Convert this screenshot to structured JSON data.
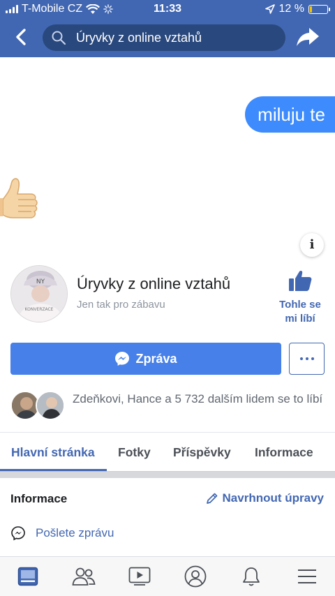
{
  "status_bar": {
    "carrier": "T-Mobile CZ",
    "time": "11:33",
    "battery_percent": "12 %",
    "battery_level": 0.12
  },
  "nav": {
    "search_query": "Úryvky z online vztahů",
    "icons": {
      "back": "chevron-left-icon",
      "search": "search-icon",
      "share": "share-icon"
    }
  },
  "cover": {
    "chat_bubble_text": "miluju te",
    "thumb_icon": "thumbs-up-emoji",
    "info_icon": "info-icon"
  },
  "page": {
    "title": "Úryvky z online vztahů",
    "subtitle": "Jen tak pro zábavu",
    "like_label_line1": "Tohle se",
    "like_label_line2": "mi líbí",
    "message_button": "Zpráva",
    "more_icon": "more-icon",
    "likes_summary": "Zdeňkovi, Hance a 5 732 dalším lidem se to líbí"
  },
  "tabs": [
    {
      "label": "Hlavní stránka",
      "active": true
    },
    {
      "label": "Fotky",
      "active": false
    },
    {
      "label": "Příspěvky",
      "active": false
    },
    {
      "label": "Informace",
      "active": false
    }
  ],
  "info_section": {
    "title": "Informace",
    "suggest_edits": "Navrhnout úpravy",
    "send_message": "Pošlete zprávu"
  },
  "bottom_bar": [
    "news-feed-icon",
    "friends-icon",
    "watch-icon",
    "profile-icon",
    "notifications-icon",
    "menu-icon"
  ],
  "colors": {
    "header_blue": "#4267b2",
    "search_pill": "#29487d",
    "message_button": "#4680e8",
    "chat_bubble": "#3d8bfd",
    "battery_fill": "#f5c400"
  }
}
